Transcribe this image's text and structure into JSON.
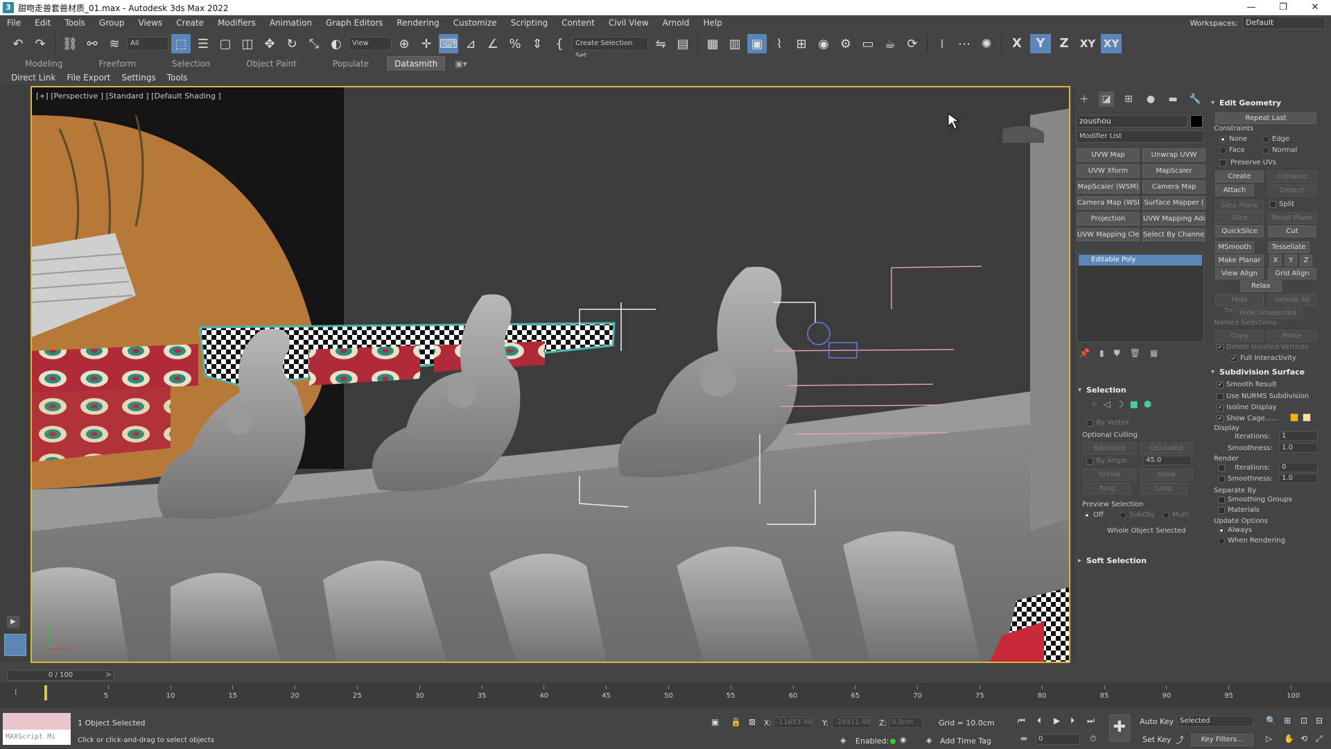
{
  "window": {
    "title": "甜吻走兽套兽材质_01.max - Autodesk 3ds Max 2022",
    "controls": [
      "—",
      "❐",
      "✕"
    ]
  },
  "menu": {
    "items": [
      "File",
      "Edit",
      "Tools",
      "Group",
      "Views",
      "Create",
      "Modifiers",
      "Animation",
      "Graph Editors",
      "Rendering",
      "Customize",
      "Scripting",
      "Content",
      "Civil View",
      "Arnold",
      "Help"
    ],
    "workspace_label": "Workspaces:",
    "workspace_value": "Default"
  },
  "toolbar": {
    "filter_value": "All",
    "ref_coord_value": "View",
    "selection_set_value": "Create Selection Set",
    "axes": [
      "X",
      "Y",
      "Z",
      "XY",
      "XY"
    ]
  },
  "ribbon": {
    "tabs": [
      "Modeling",
      "Freeform",
      "Selection",
      "Object Paint",
      "Populate",
      "Datasmith"
    ],
    "active_tab": "Datasmith",
    "sub_items": [
      "Direct Link",
      "File Export",
      "Settings",
      "Tools"
    ]
  },
  "viewport": {
    "label": "[+] [Perspective ] [Standard ] [Default Shading ]",
    "axis_x": "x",
    "axis_y": "y"
  },
  "command_panel": {
    "object_name": "zoushou",
    "modifier_list_label": "Modifier List",
    "modifier_buttons": [
      "UVW Map",
      "Unwrap UVW",
      "UVW Xform",
      "MapScaler",
      "MapScaler (WSM)",
      "Camera Map",
      "Camera Map (WSM)",
      "Surface Mapper (",
      "Projection",
      "UVW Mapping Add",
      "UVW Mapping Clear",
      "Select By Channel"
    ],
    "stack_item": "Editable Poly",
    "selection": {
      "title": "Selection",
      "by_vertex": "By Vertex",
      "optional_culling": "Optional Culling",
      "backface": "Backface",
      "occluded": "Occluded",
      "by_angle": "By Angle:",
      "angle_value": "45.0",
      "shrink": "Shrink",
      "grow": "Grow",
      "ring": "Ring",
      "loop": "Loop",
      "preview_selection": "Preview Selection",
      "off": "Off",
      "subobj": "SubObj",
      "multi": "Multi",
      "status": "Whole Object Selected"
    },
    "soft_selection": "Soft Selection",
    "edit_geometry": {
      "title": "Edit Geometry",
      "repeat_last": "Repeat Last",
      "constraints": "Constraints",
      "none": "None",
      "edge": "Edge",
      "face": "Face",
      "normal": "Normal",
      "preserve_uvs": "Preserve UVs",
      "create": "Create",
      "collapse": "Collapse",
      "attach": "Attach",
      "detach": "Detach",
      "slice_plane": "Slice Plane",
      "split": "Split",
      "slice": "Slice",
      "reset_plane": "Reset Plane",
      "quickslice": "QuickSlice",
      "cut": "Cut",
      "msmooth": "MSmooth",
      "tessellate": "Tessellate",
      "make_planar": "Make Planar",
      "x": "X",
      "y": "Y",
      "z": "Z",
      "view_align": "View Align",
      "grid_align": "Grid Align",
      "relax": "Relax",
      "hide_selected": "Hide Selected",
      "unhide_all": "Unhide All",
      "hide_unselected": "Hide Unselected",
      "named_selections": "Named Selections:",
      "copy": "Copy",
      "paste": "Paste",
      "delete_isolated": "Delete Isolated Vertices",
      "full_interactivity": "Full Interactivity"
    },
    "subdivision": {
      "title": "Subdivision Surface",
      "smooth_result": "Smooth Result",
      "use_nurms": "Use NURMS Subdivision",
      "isoline": "Isoline Display",
      "show_cage": "Show Cage......",
      "display": "Display",
      "iterations": "Iterations:",
      "iter_value": "1",
      "smoothness": "Smoothness:",
      "smooth_value": "1.0",
      "render": "Render",
      "r_iter_value": "0",
      "r_smooth_value": "1.0",
      "separate_by": "Separate By",
      "smoothing_groups": "Smoothing Groups",
      "materials": "Materials",
      "update_options": "Update Options",
      "always": "Always",
      "when_rendering": "When Rendering",
      "cage_color_1": "#f0b300",
      "cage_color_2": "#f4e3a0"
    }
  },
  "timeline": {
    "frame_display": "0 / 100",
    "ticks": [
      "5",
      "10",
      "15",
      "20",
      "25",
      "30",
      "35",
      "40",
      "45",
      "50",
      "55",
      "60",
      "65",
      "70",
      "75",
      "80",
      "85",
      "90",
      "95",
      "100"
    ]
  },
  "status": {
    "maxscript_label": "MAXScript Mi",
    "selected": "1 Object Selected",
    "prompt": "Click or click-and-drag to select objects",
    "x_label": "X:",
    "x_value": "-11653.98",
    "y_label": "Y:",
    "y_value": "-28911.48",
    "z_label": "Z:",
    "z_value": "0.0cm",
    "grid": "Grid = 10.0cm",
    "enabled_label": "Enabled:",
    "add_time_tag": "Add Time Tag",
    "auto_key": "Auto Key",
    "selected_mode": "Selected",
    "set_key": "Set Key",
    "key_filters": "Key Filters...",
    "frame_value": "0"
  }
}
